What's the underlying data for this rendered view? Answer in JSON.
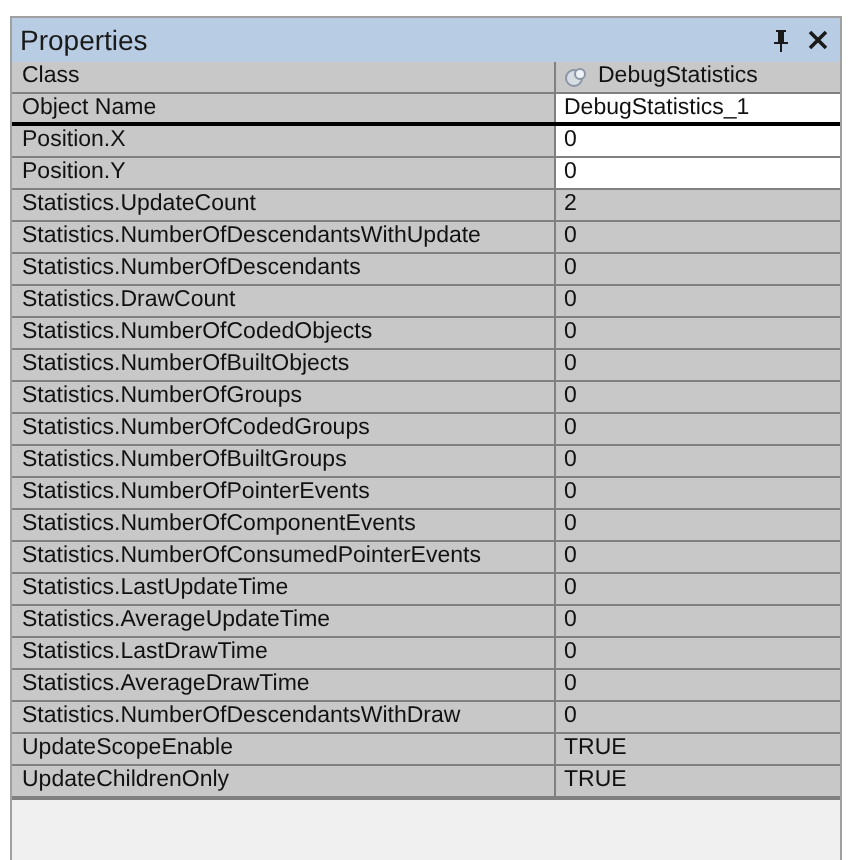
{
  "panel": {
    "title": "Properties"
  },
  "rows": [
    {
      "name": "Class",
      "value": "DebugStatistics",
      "editable": false,
      "selected": false,
      "kind": "class"
    },
    {
      "name": "Object Name",
      "value": "DebugStatistics_1",
      "editable": true,
      "selected": true,
      "kind": "text"
    },
    {
      "name": "Position.X",
      "value": "0",
      "editable": true,
      "selected": false,
      "kind": "text"
    },
    {
      "name": "Position.Y",
      "value": "0",
      "editable": true,
      "selected": false,
      "kind": "text"
    },
    {
      "name": "Statistics.UpdateCount",
      "value": "2",
      "editable": false,
      "selected": false,
      "kind": "text"
    },
    {
      "name": "Statistics.NumberOfDescendantsWithUpdate",
      "value": "0",
      "editable": false,
      "selected": false,
      "kind": "text"
    },
    {
      "name": "Statistics.NumberOfDescendants",
      "value": "0",
      "editable": false,
      "selected": false,
      "kind": "text"
    },
    {
      "name": "Statistics.DrawCount",
      "value": "0",
      "editable": false,
      "selected": false,
      "kind": "text"
    },
    {
      "name": "Statistics.NumberOfCodedObjects",
      "value": "0",
      "editable": false,
      "selected": false,
      "kind": "text"
    },
    {
      "name": "Statistics.NumberOfBuiltObjects",
      "value": "0",
      "editable": false,
      "selected": false,
      "kind": "text"
    },
    {
      "name": "Statistics.NumberOfGroups",
      "value": "0",
      "editable": false,
      "selected": false,
      "kind": "text"
    },
    {
      "name": "Statistics.NumberOfCodedGroups",
      "value": "0",
      "editable": false,
      "selected": false,
      "kind": "text"
    },
    {
      "name": "Statistics.NumberOfBuiltGroups",
      "value": "0",
      "editable": false,
      "selected": false,
      "kind": "text"
    },
    {
      "name": "Statistics.NumberOfPointerEvents",
      "value": "0",
      "editable": false,
      "selected": false,
      "kind": "text"
    },
    {
      "name": "Statistics.NumberOfComponentEvents",
      "value": "0",
      "editable": false,
      "selected": false,
      "kind": "text"
    },
    {
      "name": "Statistics.NumberOfConsumedPointerEvents",
      "value": "0",
      "editable": false,
      "selected": false,
      "kind": "text"
    },
    {
      "name": "Statistics.LastUpdateTime",
      "value": "0",
      "editable": false,
      "selected": false,
      "kind": "text"
    },
    {
      "name": "Statistics.AverageUpdateTime",
      "value": "0",
      "editable": false,
      "selected": false,
      "kind": "text"
    },
    {
      "name": "Statistics.LastDrawTime",
      "value": "0",
      "editable": false,
      "selected": false,
      "kind": "text"
    },
    {
      "name": "Statistics.AverageDrawTime",
      "value": "0",
      "editable": false,
      "selected": false,
      "kind": "text"
    },
    {
      "name": "Statistics.NumberOfDescendantsWithDraw",
      "value": "0",
      "editable": false,
      "selected": false,
      "kind": "text"
    },
    {
      "name": "UpdateScopeEnable",
      "value": "TRUE",
      "editable": false,
      "selected": false,
      "kind": "text"
    },
    {
      "name": "UpdateChildrenOnly",
      "value": "TRUE",
      "editable": false,
      "selected": false,
      "kind": "text"
    }
  ]
}
